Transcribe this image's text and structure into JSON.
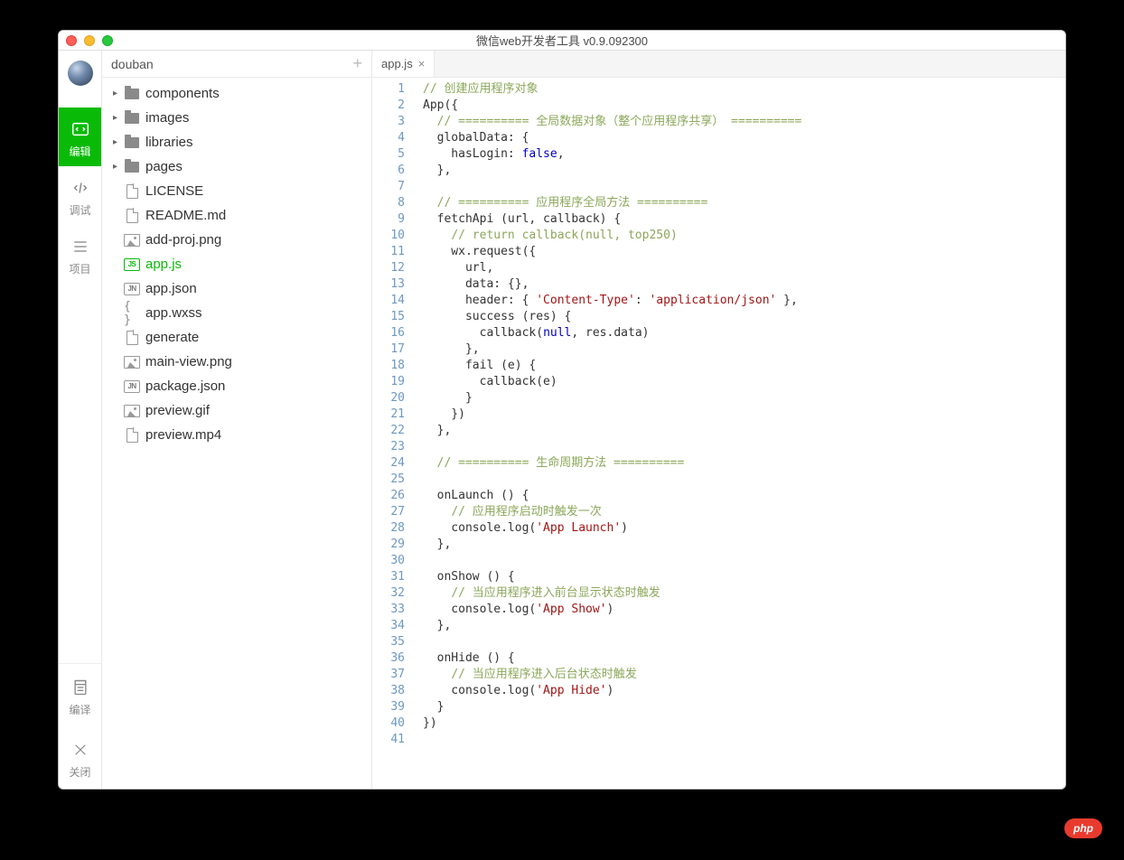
{
  "window_title": "微信web开发者工具 v0.9.092300",
  "project_name": "douban",
  "sidebar": {
    "items": [
      {
        "label": "编辑",
        "icon": "code-icon"
      },
      {
        "label": "调试",
        "icon": "debug-icon"
      },
      {
        "label": "项目",
        "icon": "project-icon"
      }
    ],
    "bottom": [
      {
        "label": "编译",
        "icon": "compile-icon"
      },
      {
        "label": "关闭",
        "icon": "close-icon"
      }
    ]
  },
  "tree": [
    {
      "type": "folder",
      "name": "components"
    },
    {
      "type": "folder",
      "name": "images"
    },
    {
      "type": "folder",
      "name": "libraries"
    },
    {
      "type": "folder",
      "name": "pages"
    },
    {
      "type": "file",
      "name": "LICENSE",
      "icon": "file"
    },
    {
      "type": "file",
      "name": "README.md",
      "icon": "file"
    },
    {
      "type": "file",
      "name": "add-proj.png",
      "icon": "img"
    },
    {
      "type": "file",
      "name": "app.js",
      "icon": "js",
      "active": true
    },
    {
      "type": "file",
      "name": "app.json",
      "icon": "jn"
    },
    {
      "type": "file",
      "name": "app.wxss",
      "icon": "braces"
    },
    {
      "type": "file",
      "name": "generate",
      "icon": "file"
    },
    {
      "type": "file",
      "name": "main-view.png",
      "icon": "img"
    },
    {
      "type": "file",
      "name": "package.json",
      "icon": "jn"
    },
    {
      "type": "file",
      "name": "preview.gif",
      "icon": "img"
    },
    {
      "type": "file",
      "name": "preview.mp4",
      "icon": "file"
    }
  ],
  "tabs": [
    {
      "label": "app.js",
      "active": true
    }
  ],
  "code": [
    [
      {
        "t": "com",
        "v": "// 创建应用程序对象"
      }
    ],
    [
      {
        "t": "id",
        "v": "App({"
      }
    ],
    [
      {
        "t": "id",
        "v": "  "
      },
      {
        "t": "com",
        "v": "// ========== 全局数据对象（整个应用程序共享） =========="
      }
    ],
    [
      {
        "t": "id",
        "v": "  globalData: {"
      }
    ],
    [
      {
        "t": "id",
        "v": "    hasLogin: "
      },
      {
        "t": "lit",
        "v": "false"
      },
      {
        "t": "id",
        "v": ","
      }
    ],
    [
      {
        "t": "id",
        "v": "  },"
      }
    ],
    [
      {
        "t": "id",
        "v": ""
      }
    ],
    [
      {
        "t": "id",
        "v": "  "
      },
      {
        "t": "com",
        "v": "// ========== 应用程序全局方法 =========="
      }
    ],
    [
      {
        "t": "id",
        "v": "  fetchApi (url, callback) {"
      }
    ],
    [
      {
        "t": "id",
        "v": "    "
      },
      {
        "t": "com",
        "v": "// return callback(null, top250)"
      }
    ],
    [
      {
        "t": "id",
        "v": "    wx.request({"
      }
    ],
    [
      {
        "t": "id",
        "v": "      url,"
      }
    ],
    [
      {
        "t": "id",
        "v": "      data: {},"
      }
    ],
    [
      {
        "t": "id",
        "v": "      header: { "
      },
      {
        "t": "str",
        "v": "'Content-Type'"
      },
      {
        "t": "id",
        "v": ": "
      },
      {
        "t": "str",
        "v": "'application/json'"
      },
      {
        "t": "id",
        "v": " },"
      }
    ],
    [
      {
        "t": "id",
        "v": "      success (res) {"
      }
    ],
    [
      {
        "t": "id",
        "v": "        callback("
      },
      {
        "t": "lit",
        "v": "null"
      },
      {
        "t": "id",
        "v": ", res.data)"
      }
    ],
    [
      {
        "t": "id",
        "v": "      },"
      }
    ],
    [
      {
        "t": "id",
        "v": "      fail (e) {"
      }
    ],
    [
      {
        "t": "id",
        "v": "        callback(e)"
      }
    ],
    [
      {
        "t": "id",
        "v": "      }"
      }
    ],
    [
      {
        "t": "id",
        "v": "    })"
      }
    ],
    [
      {
        "t": "id",
        "v": "  },"
      }
    ],
    [
      {
        "t": "id",
        "v": ""
      }
    ],
    [
      {
        "t": "id",
        "v": "  "
      },
      {
        "t": "com",
        "v": "// ========== 生命周期方法 =========="
      }
    ],
    [
      {
        "t": "id",
        "v": ""
      }
    ],
    [
      {
        "t": "id",
        "v": "  onLaunch () {"
      }
    ],
    [
      {
        "t": "id",
        "v": "    "
      },
      {
        "t": "com",
        "v": "// 应用程序启动时触发一次"
      }
    ],
    [
      {
        "t": "id",
        "v": "    console.log("
      },
      {
        "t": "str",
        "v": "'App Launch'"
      },
      {
        "t": "id",
        "v": ")"
      }
    ],
    [
      {
        "t": "id",
        "v": "  },"
      }
    ],
    [
      {
        "t": "id",
        "v": ""
      }
    ],
    [
      {
        "t": "id",
        "v": "  onShow () {"
      }
    ],
    [
      {
        "t": "id",
        "v": "    "
      },
      {
        "t": "com",
        "v": "// 当应用程序进入前台显示状态时触发"
      }
    ],
    [
      {
        "t": "id",
        "v": "    console.log("
      },
      {
        "t": "str",
        "v": "'App Show'"
      },
      {
        "t": "id",
        "v": ")"
      }
    ],
    [
      {
        "t": "id",
        "v": "  },"
      }
    ],
    [
      {
        "t": "id",
        "v": ""
      }
    ],
    [
      {
        "t": "id",
        "v": "  onHide () {"
      }
    ],
    [
      {
        "t": "id",
        "v": "    "
      },
      {
        "t": "com",
        "v": "// 当应用程序进入后台状态时触发"
      }
    ],
    [
      {
        "t": "id",
        "v": "    console.log("
      },
      {
        "t": "str",
        "v": "'App Hide'"
      },
      {
        "t": "id",
        "v": ")"
      }
    ],
    [
      {
        "t": "id",
        "v": "  }"
      }
    ],
    [
      {
        "t": "id",
        "v": "})"
      }
    ],
    [
      {
        "t": "id",
        "v": ""
      }
    ]
  ],
  "badge": "php"
}
